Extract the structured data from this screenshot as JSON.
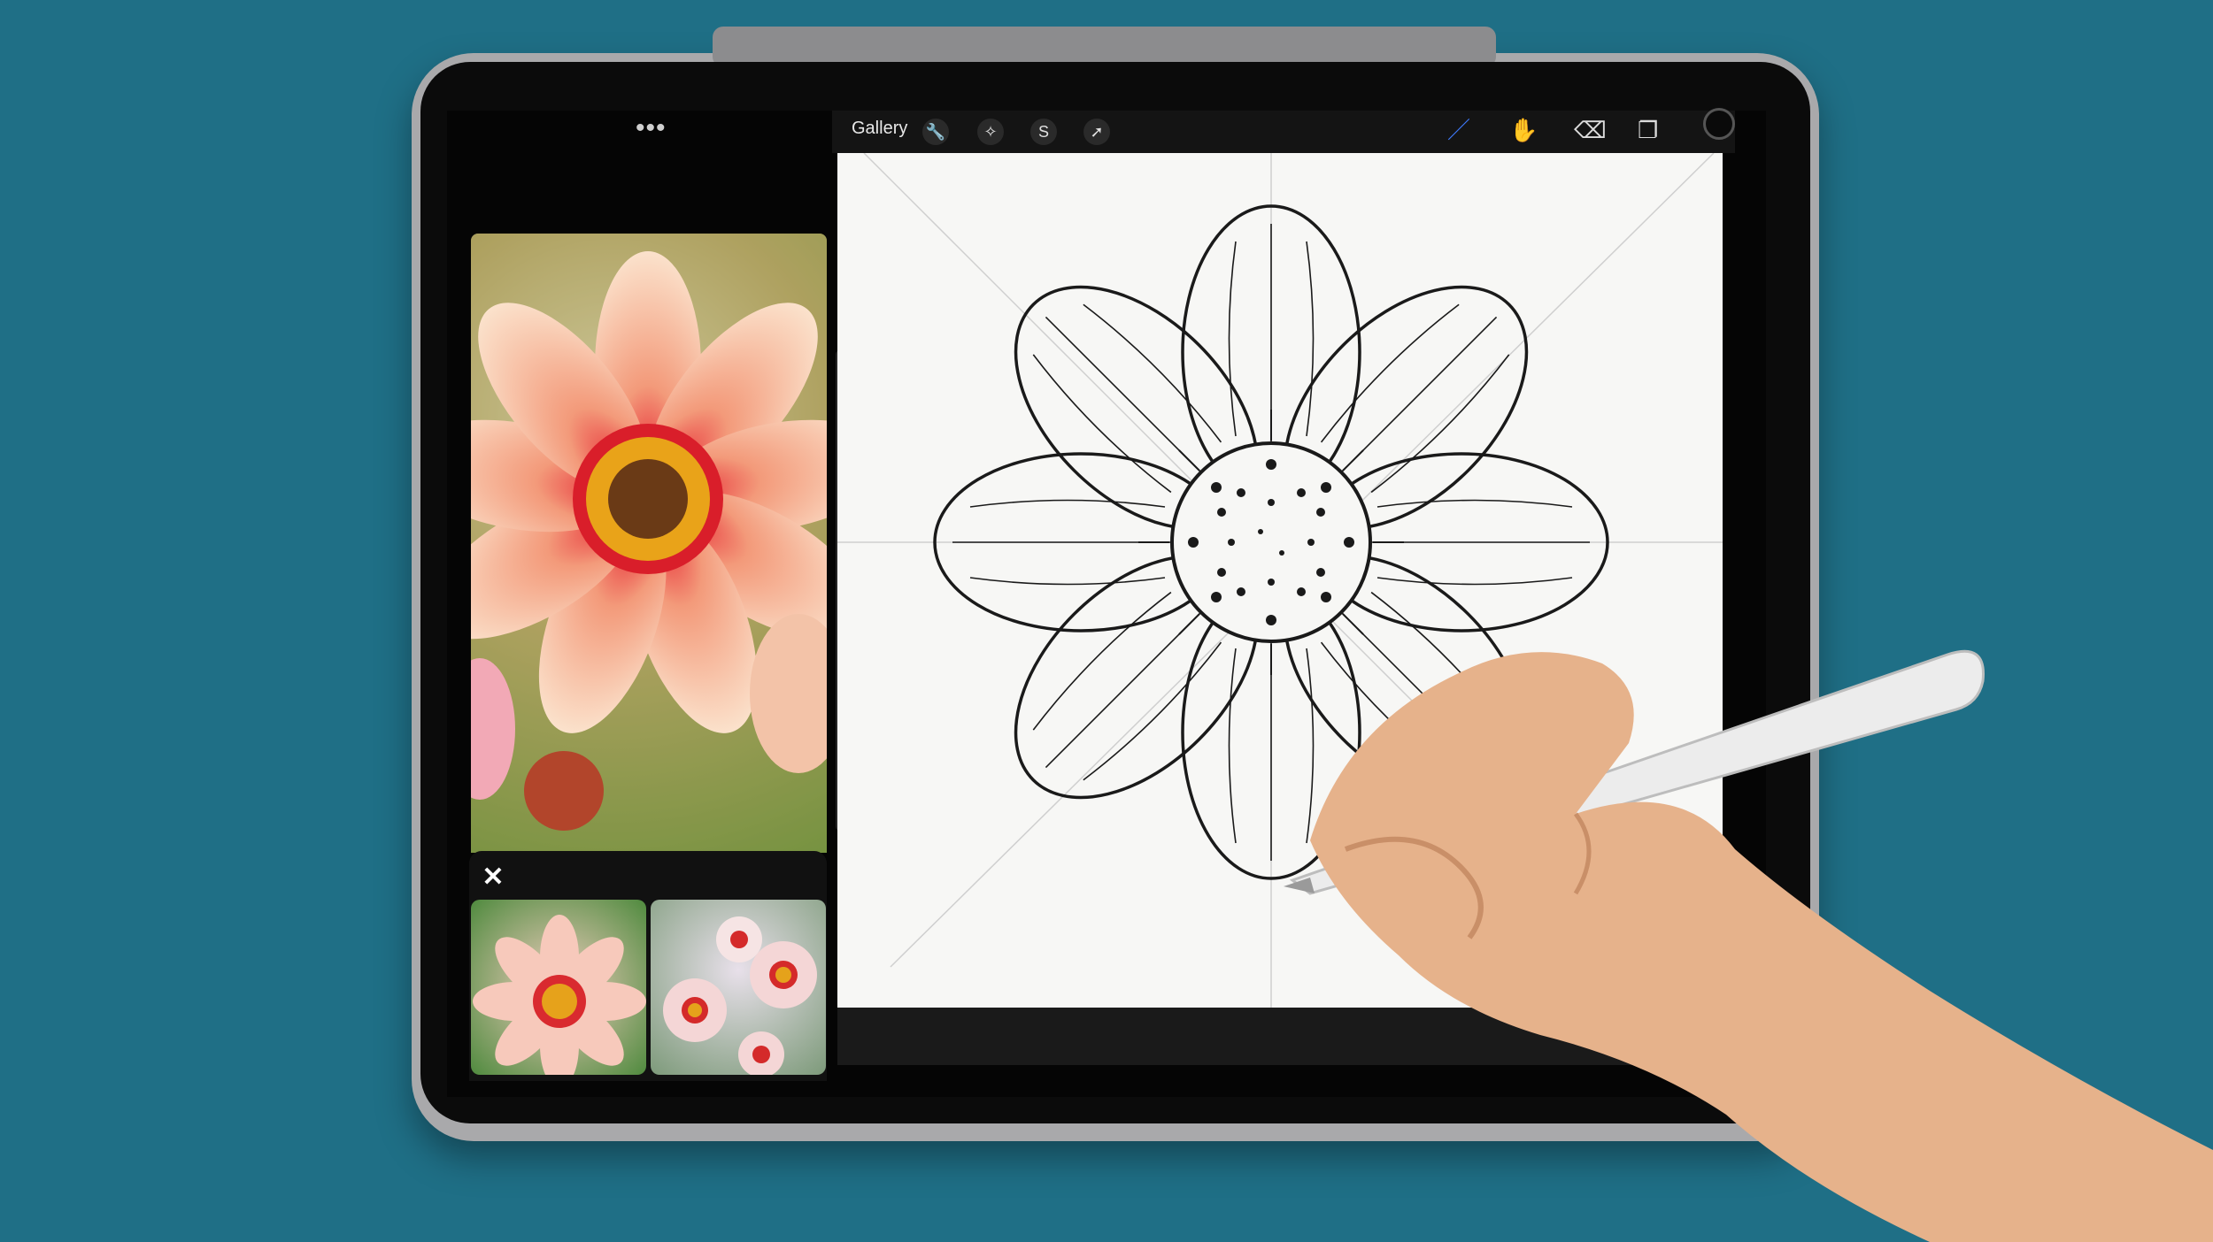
{
  "toolbar": {
    "gallery_label": "Gallery",
    "left_tools": [
      {
        "name": "wrench-icon",
        "glyph": "🔧"
      },
      {
        "name": "adjustments-wand-icon",
        "glyph": "✧"
      },
      {
        "name": "selection-s-icon",
        "glyph": "S"
      },
      {
        "name": "transform-arrow-icon",
        "glyph": "➚"
      }
    ],
    "right_tools": [
      {
        "name": "brush-icon",
        "glyph": "／",
        "color": "#3f7bff"
      },
      {
        "name": "smudge-icon",
        "glyph": "✋",
        "color": "#dcdcdc"
      },
      {
        "name": "eraser-icon",
        "glyph": "⌫",
        "color": "#dcdcdc"
      },
      {
        "name": "layers-icon",
        "glyph": "❐",
        "color": "#dcdcdc"
      }
    ],
    "current_color": "#0a0a0a"
  },
  "multitask": {
    "dots": "•••"
  },
  "reference": {
    "close_glyph": "✕"
  },
  "sidebar": {
    "undo_glyph": "↶",
    "redo_glyph": "↷"
  }
}
